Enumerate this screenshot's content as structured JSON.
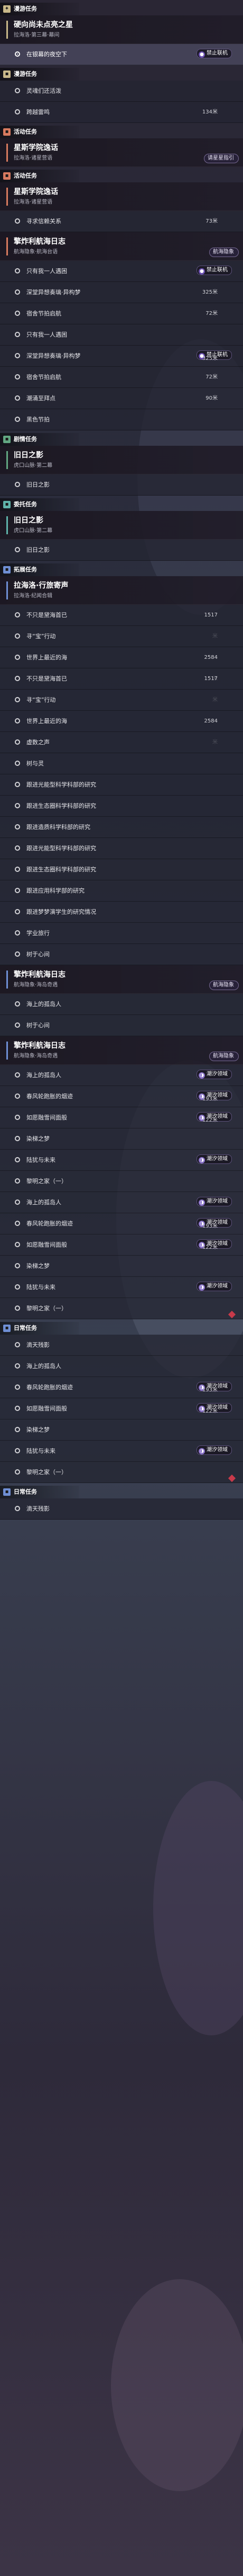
{
  "colors": {
    "tan": "#c9b88a",
    "red": "#d77a5f",
    "green": "#62a782",
    "teal": "#5fb3aa",
    "blue": "#6f8fd4",
    "purple_badge": "#6a4fb1",
    "diamond_red": "#c83a4a"
  },
  "first_icon": "diamond-star-icon",
  "sections": [
    {
      "header": "漫游任务",
      "color": "tan",
      "blocks": [
        {
          "title": "硬向尚未点亮之星",
          "subtitle": "拉海洛·第三幕·幕间",
          "rows": [
            {
              "label": "在银幕的夜空下",
              "selected": true,
              "badge": "禁止联机"
            }
          ]
        }
      ]
    },
    {
      "header": "漫游任务",
      "color": "tan",
      "blocks": [
        {
          "rows": [
            {
              "label": "灵魂们还活泼"
            },
            {
              "label": "跨越雷鸣",
              "distance": "134米"
            }
          ]
        }
      ]
    },
    {
      "header": "活动任务",
      "color": "red",
      "blocks": [
        {
          "title": "星斯学院逸话",
          "subtitle": "拉海洛·诸星营语",
          "badge": "请星星指引"
        }
      ]
    },
    {
      "header": "活动任务",
      "color": "red",
      "blocks": [
        {
          "title": "星斯学院逸话",
          "subtitle": "拉海洛·诸星营语",
          "rows": [
            {
              "label": "寻求信赖关系",
              "distance": "73米"
            }
          ]
        },
        {
          "title": "擎炸利航海日志",
          "subtitle": "航海隐象·航海台语",
          "badge": "航海隐象",
          "rows": [
            {
              "label": "只有我一人遇困",
              "badge": "禁止联机",
              "distance": ""
            },
            {
              "label": "深堂异想奏璃·异构梦",
              "distance": "325米"
            },
            {
              "label": "宿舍节拍启航",
              "distance": "72米"
            },
            {
              "label": "只有我一人遇困"
            },
            {
              "label": "深堂异想奏璃·异构梦",
              "badge": "禁止联机",
              "distance": "325米"
            },
            {
              "label": "宿舍节拍启航",
              "distance": "72米"
            },
            {
              "label": "潮涌至拜点",
              "distance": "90米"
            },
            {
              "label": "黑色节拍"
            }
          ]
        }
      ]
    },
    {
      "header": "剧情任务",
      "color": "green",
      "blocks": [
        {
          "title": "旧日之影",
          "subtitle": "虎口山脉·第二幕",
          "rows": [
            {
              "label": "旧日之影"
            }
          ]
        }
      ]
    },
    {
      "header": "委托任务",
      "color": "teal",
      "blocks": [
        {
          "title": "旧日之影",
          "subtitle": "虎口山脉·第二幕",
          "rows": [
            {
              "label": "旧日之影"
            }
          ]
        }
      ]
    },
    {
      "header": "拓展任务",
      "color": "blue",
      "blocks": [
        {
          "title": "拉海洛·行旅寄声",
          "subtitle": "拉海洛·纪闻合辑",
          "rows": [
            {
              "label": "不只是黛海首已",
              "distance": "1517米"
            },
            {
              "label": "寻“宝”行动"
            },
            {
              "label": "世界上最近的海",
              "distance": "2584米"
            },
            {
              "label": "不只是黛海首已",
              "distance": "1517米"
            },
            {
              "label": "寻“宝”行动"
            },
            {
              "label": "世界上最近的海",
              "distance": "2584米"
            },
            {
              "label": "虚数之声"
            },
            {
              "label": "树与灵"
            },
            {
              "label": "跟进光能型科学科部的研究"
            },
            {
              "label": "跟进生态圈科学科部的研究"
            },
            {
              "label": "跟进造质科学科部的研究"
            },
            {
              "label": "跟进光能型科学科部的研究"
            },
            {
              "label": "跟进生态圈科学科部的研究"
            },
            {
              "label": "跟进应用科学部的研究"
            },
            {
              "label": "跟进梦梦演学生的研究情况"
            },
            {
              "label": "学业旅行"
            },
            {
              "label": "树于心间"
            }
          ]
        },
        {
          "title": "擎炸利航海日志",
          "subtitle": "航海隐象·海岛奇遇",
          "badge": "航海隐象",
          "rows": [
            {
              "label": "海上的孤岛人"
            },
            {
              "label": "树于心间"
            }
          ]
        },
        {
          "title": "擎炸利航海日志",
          "subtitle": "航海隐象·海岛奇遇",
          "badge": "航海隐象",
          "rows": [
            {
              "label": "海上的孤岛人",
              "badge": "潮汐领域",
              "distance": ""
            },
            {
              "label": "春风轮跑胀的烟迹",
              "badge": "潮汐领域",
              "distance": "193米"
            },
            {
              "label": "如愿融雪间面般",
              "badge": "潮汐领域",
              "distance": "122米"
            },
            {
              "label": "染梯之梦"
            },
            {
              "label": "陆犹与未来",
              "badge": "潮汐领域",
              "distance": ""
            },
            {
              "label": "黎明之家（一）"
            },
            {
              "label": "海上的孤岛人",
              "badge": "潮汐领域",
              "distance": ""
            },
            {
              "label": "春风轮跑胀的烟迹",
              "badge": "潮汐领域",
              "distance": "193米"
            },
            {
              "label": "如愿融雪间面般",
              "badge": "潮汐领域",
              "distance": "122米"
            },
            {
              "label": "染梯之梦"
            },
            {
              "label": "陆犹与未来",
              "badge": "潮汐领域",
              "distance": ""
            },
            {
              "label": "黎明之家（一）"
            }
          ]
        }
      ]
    },
    {
      "header": "日常任务",
      "color": "blue",
      "diamond": true,
      "blocks": [
        {
          "rows": [
            {
              "label": "滴天残影"
            },
            {
              "label": "海上的孤岛人"
            },
            {
              "label": "春风轮跑胀的烟迹",
              "badge": "潮汐领域",
              "distance": "193米"
            },
            {
              "label": "如愿融雪间面般",
              "badge": "潮汐领域",
              "distance": "122米"
            },
            {
              "label": "染梯之梦"
            },
            {
              "label": "陆犹与未来",
              "badge": "潮汐领域",
              "distance": ""
            },
            {
              "label": "黎明之家（一）"
            }
          ]
        }
      ]
    },
    {
      "header": "日常任务",
      "color": "blue",
      "diamond": true,
      "blocks": [
        {
          "rows": [
            {
              "label": "滴天残影"
            }
          ]
        }
      ]
    }
  ]
}
